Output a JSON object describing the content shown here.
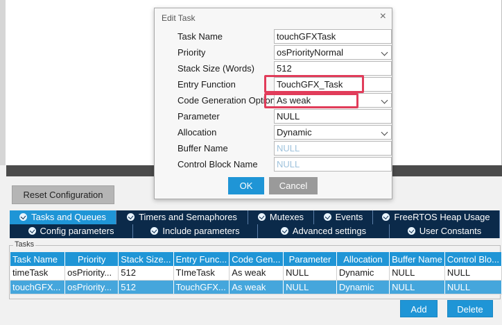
{
  "config_panel": {
    "reset_button": "Reset Configuration",
    "tabs_row1": [
      "Tasks and Queues",
      "Timers and Semaphores",
      "Mutexes",
      "Events",
      "FreeRTOS Heap Usage"
    ],
    "tabs_row2": [
      "Config parameters",
      "Include parameters",
      "Advanced settings",
      "User Constants"
    ],
    "active_tab": "Tasks and Queues"
  },
  "tasks": {
    "legend": "Tasks",
    "columns": [
      "Task Name",
      "Priority",
      "Stack Size...",
      "Entry Func...",
      "Code Gen...",
      "Parameter",
      "Allocation",
      "Buffer Name",
      "Control Blo..."
    ],
    "rows": [
      [
        "timeTask",
        "osPriority...",
        "512",
        "TImeTask",
        "As weak",
        "NULL",
        "Dynamic",
        "NULL",
        "NULL"
      ],
      [
        "touchGFX...",
        "osPriority...",
        "512",
        "TouchGFX...",
        "As weak",
        "NULL",
        "Dynamic",
        "NULL",
        "NULL"
      ]
    ],
    "selected_row": 1,
    "add_button": "Add",
    "delete_button": "Delete"
  },
  "dialog": {
    "title": "Edit Task",
    "close_glyph": "×",
    "fields": [
      {
        "label": "Task Name",
        "value": "touchGFXTask",
        "type": "text"
      },
      {
        "label": "Priority",
        "value": "osPriorityNormal",
        "type": "select"
      },
      {
        "label": "Stack Size (Words)",
        "value": "512",
        "type": "text"
      },
      {
        "label": "Entry Function",
        "value": "TouchGFX_Task",
        "type": "text",
        "highlighted": true
      },
      {
        "label": "Code Generation Option",
        "value": "As weak",
        "type": "select",
        "highlighted": true
      },
      {
        "label": "Parameter",
        "value": "NULL",
        "type": "text"
      },
      {
        "label": "Allocation",
        "value": "Dynamic",
        "type": "select"
      },
      {
        "label": "Buffer Name",
        "value": "NULL",
        "type": "placeholder"
      },
      {
        "label": "Control Block Name",
        "value": "NULL",
        "type": "placeholder"
      }
    ],
    "ok_button": "OK",
    "cancel_button": "Cancel"
  },
  "colors": {
    "accent": "#1f95d6",
    "tab_dark": "#0b2a4a",
    "highlight": "#e13c5a",
    "cancel_gray": "#9a9a9a"
  }
}
